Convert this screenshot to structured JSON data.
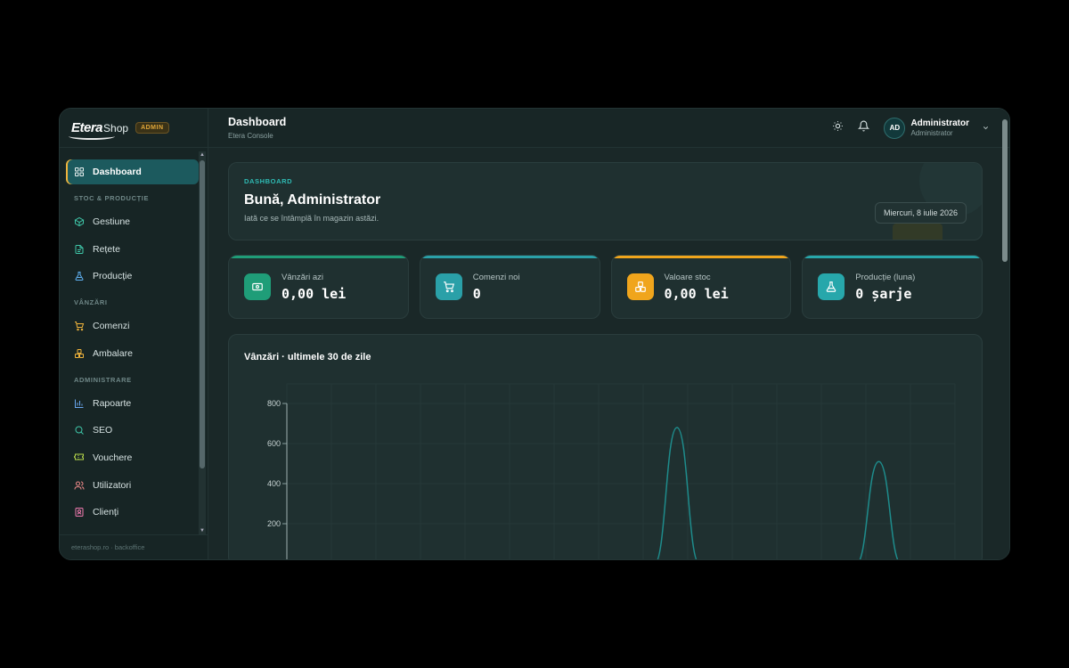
{
  "brand": {
    "logo_main": "Etera",
    "logo_sub": "Shop",
    "badge": "ADMIN"
  },
  "sidebar": {
    "active": "Dashboard",
    "sections": [
      {
        "title": "",
        "items": [
          {
            "label": "Dashboard",
            "icon": "grid-icon"
          }
        ]
      },
      {
        "title": "STOC & PRODUCȚIE",
        "items": [
          {
            "label": "Gestiune",
            "icon": "box-icon"
          },
          {
            "label": "Rețete",
            "icon": "document-icon"
          },
          {
            "label": "Producție",
            "icon": "flask-icon"
          }
        ]
      },
      {
        "title": "VÂNZĂRI",
        "items": [
          {
            "label": "Comenzi",
            "icon": "cart-icon"
          },
          {
            "label": "Ambalare",
            "icon": "boxes-icon"
          }
        ]
      },
      {
        "title": "ADMINISTRARE",
        "items": [
          {
            "label": "Rapoarte",
            "icon": "bar-chart-icon"
          },
          {
            "label": "SEO",
            "icon": "search-icon"
          },
          {
            "label": "Vouchere",
            "icon": "ticket-icon"
          },
          {
            "label": "Utilizatori",
            "icon": "users-icon"
          },
          {
            "label": "Clienți",
            "icon": "contact-icon"
          }
        ]
      }
    ],
    "footer": "eterashop.ro · backoffice"
  },
  "topbar": {
    "title": "Dashboard",
    "subtitle": "Etera Console",
    "user_initials": "AD",
    "user_name": "Administrator",
    "user_role": "Administrator"
  },
  "hero": {
    "kicker": "DASHBOARD",
    "greeting": "Bună, Administrator",
    "subtitle": "Iată ce se întâmplă în magazin astăzi.",
    "date": "Miercuri, 8 iulie 2026"
  },
  "stats": [
    {
      "label": "Vânzări azi",
      "value": "0,00 lei",
      "icon": "cash-icon",
      "color": "#1f9d78"
    },
    {
      "label": "Comenzi noi",
      "value": "0",
      "icon": "cart-icon",
      "color": "#2aa0a8"
    },
    {
      "label": "Valoare stoc",
      "value": "0,00 lei",
      "icon": "boxes-icon",
      "color": "#f0a51c"
    },
    {
      "label": "Producție (luna)",
      "value": "0 șarje",
      "icon": "flask-icon",
      "color": "#27a7ab"
    }
  ],
  "chart": {
    "title": "Vânzări · ultimele 30 de zile",
    "line_color": "#1e8c8c"
  },
  "chart_data": {
    "type": "line",
    "title": "Vânzări · ultimele 30 de zile",
    "xlabel": "",
    "ylabel": "",
    "yticks": [
      200,
      400,
      600,
      800
    ],
    "ylim": [
      0,
      800
    ],
    "x": [
      0,
      1,
      2,
      3,
      4,
      5,
      6,
      7,
      8,
      9,
      10,
      11,
      12,
      13,
      14,
      15,
      16,
      17,
      18,
      19,
      20,
      21,
      22,
      23,
      24,
      25,
      26,
      27,
      28,
      29
    ],
    "series": [
      {
        "values": [
          0,
          0,
          0,
          0,
          0,
          0,
          0,
          0,
          0,
          0,
          0,
          0,
          0,
          0,
          0,
          0,
          0,
          680,
          0,
          0,
          0,
          0,
          0,
          0,
          0,
          0,
          510,
          0,
          0,
          0
        ]
      }
    ]
  }
}
